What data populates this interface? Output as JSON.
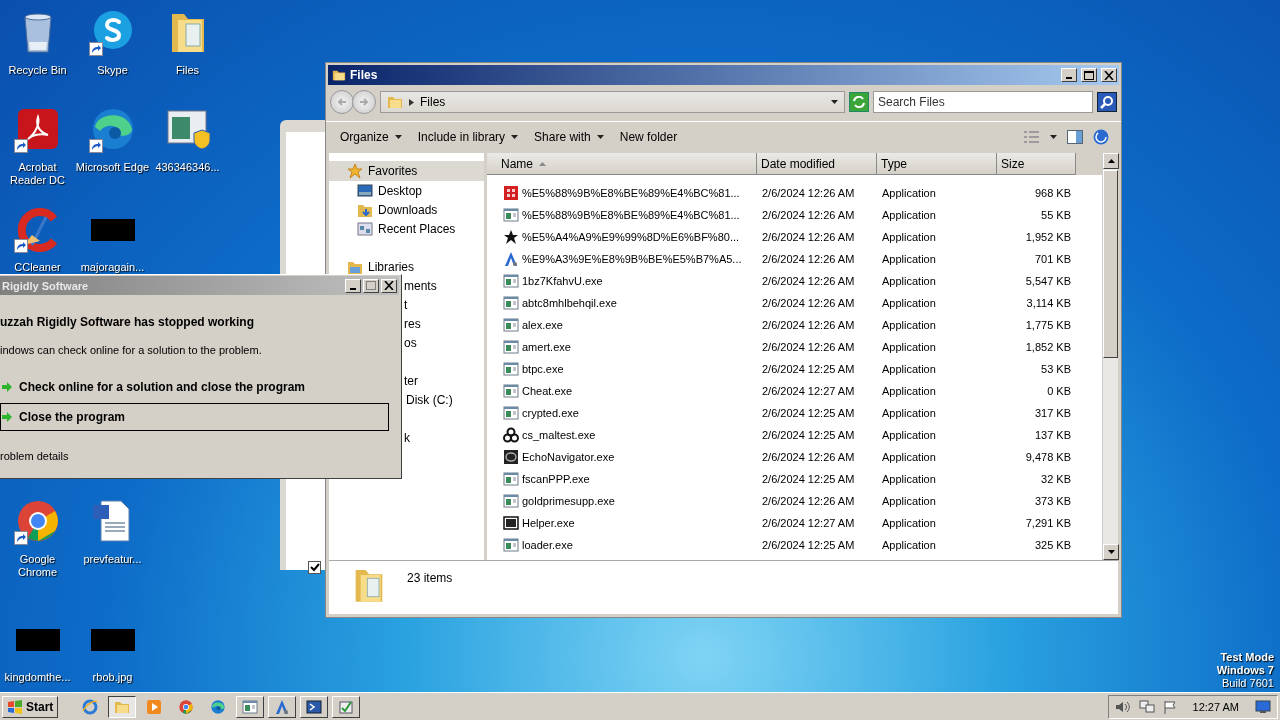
{
  "desktop": {
    "icons": [
      [
        {
          "label": "Recycle Bin",
          "kind": "recycle",
          "shortcut": false
        },
        {
          "label": "Skype",
          "kind": "skype",
          "shortcut": true
        },
        {
          "label": "Files",
          "kind": "folder",
          "shortcut": false
        }
      ],
      [
        {
          "label": "Acrobat Reader DC",
          "kind": "acrobat",
          "shortcut": true
        },
        {
          "label": "Microsoft Edge",
          "kind": "edge",
          "shortcut": true
        },
        {
          "label": "436346346...",
          "kind": "installer",
          "shortcut": false
        }
      ],
      [
        {
          "label": "CCleaner",
          "kind": "ccleaner",
          "shortcut": true
        },
        {
          "label": "majoragain...",
          "kind": "redacted",
          "shortcut": false
        }
      ],
      [
        {
          "label": "Google Chrome",
          "kind": "chrome",
          "shortcut": true
        },
        {
          "label": "prevfeatur...",
          "kind": "word",
          "shortcut": false
        }
      ],
      [
        {
          "label": "kingdomthe...",
          "kind": "redacted",
          "shortcut": false
        },
        {
          "label": "rbob.jpg",
          "kind": "redacted",
          "shortcut": false
        }
      ]
    ],
    "system_text": [
      "Test Mode",
      "Windows 7",
      "Build 7601"
    ]
  },
  "back_window": {
    "checkbox": {
      "checked": true
    }
  },
  "explorer": {
    "title": "Files",
    "address": "Files",
    "search": {
      "placeholder": "Search Files"
    },
    "toolbar": [
      {
        "label": "Organize",
        "dropdown": true
      },
      {
        "label": "Include in library",
        "dropdown": true
      },
      {
        "label": "Share with",
        "dropdown": true
      },
      {
        "label": "New folder",
        "dropdown": false
      }
    ],
    "favorites": {
      "label": "Favorites",
      "selected": true,
      "children": [
        {
          "label": "Desktop",
          "kind": "desktop"
        },
        {
          "label": "Downloads",
          "kind": "downloads"
        },
        {
          "label": "Recent Places",
          "kind": "recent"
        }
      ]
    },
    "libraries": {
      "label": "Libraries",
      "children": [
        "ments",
        "t",
        "res",
        "os"
      ]
    },
    "computer": {
      "label": "ter",
      "children": [
        "Disk (C:)"
      ]
    },
    "network": {
      "label": "k"
    },
    "columns": [
      {
        "label": "Name",
        "sorted": true
      },
      {
        "label": "Date modified",
        "sorted": false
      },
      {
        "label": "Type",
        "sorted": false
      },
      {
        "label": "Size",
        "sorted": false
      }
    ],
    "rows": [
      {
        "kind": "red",
        "name": "%E5%88%9B%E8%BE%89%E4%BC%81...",
        "date": "2/6/2024 12:26 AM",
        "type": "Application",
        "size": "968 KB"
      },
      {
        "kind": "app",
        "name": "%E5%88%9B%E8%BE%89%E4%BC%81...",
        "date": "2/6/2024 12:26 AM",
        "type": "Application",
        "size": "55 KB"
      },
      {
        "kind": "star",
        "name": "%E5%A4%A9%E9%99%8D%E6%BF%80...",
        "date": "2/6/2024 12:26 AM",
        "type": "Application",
        "size": "1,952 KB"
      },
      {
        "kind": "letter",
        "name": "%E9%A3%9E%E8%9B%BE%E5%B7%A5...",
        "date": "2/6/2024 12:26 AM",
        "type": "Application",
        "size": "701 KB"
      },
      {
        "kind": "app",
        "name": "1bz7KfahvU.exe",
        "date": "2/6/2024 12:26 AM",
        "type": "Application",
        "size": "5,547 KB"
      },
      {
        "kind": "app",
        "name": "abtc8mhlbehqil.exe",
        "date": "2/6/2024 12:26 AM",
        "type": "Application",
        "size": "3,114 KB"
      },
      {
        "kind": "app",
        "name": "alex.exe",
        "date": "2/6/2024 12:26 AM",
        "type": "Application",
        "size": "1,775 KB"
      },
      {
        "kind": "app",
        "name": "amert.exe",
        "date": "2/6/2024 12:26 AM",
        "type": "Application",
        "size": "1,852 KB"
      },
      {
        "kind": "app",
        "name": "btpc.exe",
        "date": "2/6/2024 12:25 AM",
        "type": "Application",
        "size": "53 KB"
      },
      {
        "kind": "app",
        "name": "Cheat.exe",
        "date": "2/6/2024 12:27 AM",
        "type": "Application",
        "size": "0 KB"
      },
      {
        "kind": "app",
        "name": "crypted.exe",
        "date": "2/6/2024 12:25 AM",
        "type": "Application",
        "size": "317 KB"
      },
      {
        "kind": "hazard",
        "name": "cs_maltest.exe",
        "date": "2/6/2024 12:25 AM",
        "type": "Application",
        "size": "137 KB"
      },
      {
        "kind": "dark",
        "name": "EchoNavigator.exe",
        "date": "2/6/2024 12:26 AM",
        "type": "Application",
        "size": "9,478 KB"
      },
      {
        "kind": "app",
        "name": "fscanPPP.exe",
        "date": "2/6/2024 12:25 AM",
        "type": "Application",
        "size": "32 KB"
      },
      {
        "kind": "app",
        "name": "goldprimesupp.exe",
        "date": "2/6/2024 12:26 AM",
        "type": "Application",
        "size": "373 KB"
      },
      {
        "kind": "box",
        "name": "Helper.exe",
        "date": "2/6/2024 12:27 AM",
        "type": "Application",
        "size": "7,291 KB"
      },
      {
        "kind": "app",
        "name": "loader.exe",
        "date": "2/6/2024 12:25 AM",
        "type": "Application",
        "size": "325 KB"
      }
    ],
    "status": "23 items"
  },
  "dialog": {
    "title": "Rigidly Software",
    "heading": "uzzah Rigidly Software has stopped working",
    "message": "indows can check online for a solution to the problem.",
    "options": [
      {
        "label": "Check online for a solution and close the program",
        "selected": false
      },
      {
        "label": "Close the program",
        "selected": true
      }
    ],
    "details": "roblem details"
  },
  "taskbar": {
    "start": "Start",
    "items": [
      {
        "kind": "ie",
        "selected": false
      },
      {
        "kind": "folder",
        "selected": true
      },
      {
        "kind": "media",
        "selected": false
      },
      {
        "kind": "chrome",
        "selected": false
      },
      {
        "kind": "edge",
        "selected": false
      },
      {
        "kind": "app",
        "selected": false
      },
      {
        "kind": "letter",
        "selected": false
      },
      {
        "kind": "shell",
        "selected": false
      },
      {
        "kind": "tool",
        "selected": false
      }
    ],
    "clock": "12:27 AM"
  }
}
